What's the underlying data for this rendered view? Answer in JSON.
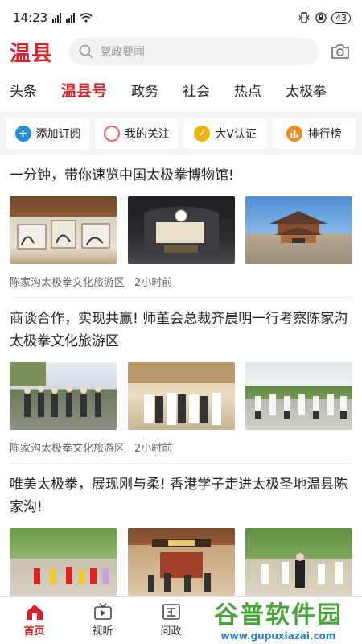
{
  "status": {
    "time": "14:23",
    "signal1": "5G",
    "signal2": "4G",
    "battery": "43"
  },
  "header": {
    "logo": "温县",
    "search_placeholder": "党政要闻"
  },
  "tabs": [
    "头条",
    "温县号",
    "政务",
    "社会",
    "热点",
    "太极拳"
  ],
  "active_tab": 1,
  "quick": [
    {
      "label": "添加订阅",
      "icon": "plus-icon"
    },
    {
      "label": "我的关注",
      "icon": "circle-icon"
    },
    {
      "label": "大V认证",
      "icon": "check-icon"
    },
    {
      "label": "排行榜",
      "icon": "bar-chart-icon"
    }
  ],
  "articles": [
    {
      "title": "一分钟，带你速览中国太极拳博物馆!",
      "source": "陈家沟太极拳文化旅游区",
      "time": "2小时前"
    },
    {
      "title": "商谈合作，实现共赢! 师董会总裁齐晨明一行考察陈家沟太极拳文化旅游区",
      "source": "陈家沟太极拳文化旅游区",
      "time": "2小时前"
    },
    {
      "title": "唯美太极拳，展现刚与柔! 香港学子走进太极圣地温县陈家沟!",
      "source": "",
      "time": ""
    }
  ],
  "nav": [
    {
      "label": "首页",
      "icon": "home-icon"
    },
    {
      "label": "视听",
      "icon": "tv-icon"
    },
    {
      "label": "问政",
      "icon": "zheng-icon"
    }
  ],
  "watermark": {
    "main": "谷普软件园",
    "sub": "www.gupuxiazai.com"
  }
}
